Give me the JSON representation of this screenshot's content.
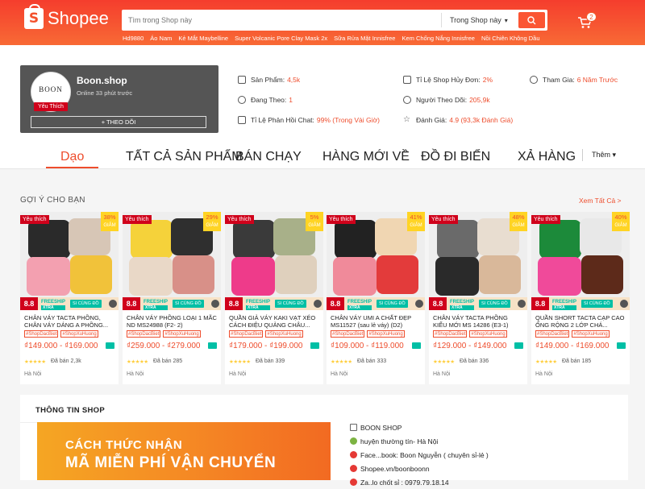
{
  "header": {
    "brand": "Shopee",
    "search_placeholder": "Tìm trong Shop này",
    "search_scope": "Trong Shop này",
    "cart_count": "2",
    "hints": [
      "Hd9880",
      "Áo Nam",
      "Kẻ Mắt Maybelline",
      "Super Volcanic Pore Clay Mask 2x",
      "Sữa Rửa Mặt Innisfree",
      "Kem Chống Nắng Innisfree",
      "Nồi Chiên Không Dầu"
    ]
  },
  "shop": {
    "logo_text": "BOON",
    "badge": "Yêu Thích",
    "name": "Boon.shop",
    "online": "Online 33 phút trước",
    "follow_label": "+ THEO DÕI",
    "stats": {
      "products_label": "Sản Phẩm:",
      "products_value": "4,5k",
      "following_label": "Đang Theo:",
      "following_value": "1",
      "chat_label": "Tỉ Lệ Phản Hồi Chat:",
      "chat_value": "99% (Trong Vài Giờ)",
      "cancel_label": "Tỉ Lệ Shop Hủy Đơn:",
      "cancel_value": "2%",
      "followers_label": "Người Theo Dõi:",
      "followers_value": "205,9k",
      "rating_label": "Đánh Giá:",
      "rating_value": "4.9 (93,3k Đánh Giá)",
      "joined_label": "Tham Gia:",
      "joined_value": "6 Năm Trước"
    }
  },
  "tabs": [
    "Dạo",
    "TẤT CẢ SẢN PHẨM",
    "BÁN CHẠY",
    "HÀNG MỚI VỀ",
    "ĐỒ ĐI BIỂN",
    "XẢ HÀNG"
  ],
  "more_label": "Thêm ▾",
  "section": {
    "title": "GỢI Ý CHO BẠN",
    "see_all": "Xem Tất Cả >"
  },
  "product_common": {
    "badge": "Yêu thích",
    "discount_suffix": "GIẢM",
    "mall_tag": "8.8",
    "freeship": "FREESHIP",
    "xtra": "XTRA",
    "gift": "SI CÙNG ĐỒ",
    "tags": [
      "#ShopDacBiet",
      "#ShopXuHuong"
    ],
    "location": "Hà Nội",
    "stars": "★★★★★"
  },
  "products": [
    {
      "name": "CHÂN VÁY TACTA PHỒNG, CHÂN VÁY DÁNG A PHỒNG...",
      "discount": "38%",
      "price": "₫149.000 - ₫169.000",
      "sold": "Đã bán 2,3k"
    },
    {
      "name": "CHÂN VÁY PHỒNG LOẠI 1 MÃC ND MS24988 (F2- 2)",
      "discount": "29%",
      "price": "₫259.000 - ₫279.000",
      "sold": "Đã bán 285"
    },
    {
      "name": "QUẦN GIẢ VÁY KAKI VẠT XÉO CÁCH ĐIỆU QUẢNG CHÂU...",
      "discount": "5%",
      "price": "₫179.000 - ₫199.000",
      "sold": "Đã bán 339"
    },
    {
      "name": "CHÂN VÁY UMI A CHẤT ĐẸP MS11527 (sau lẻ váy) (D2)",
      "discount": "41%",
      "price": "₫109.000 - ₫119.000",
      "sold": "Đã bán 333"
    },
    {
      "name": "CHÂN VÁY TACTA PHỒNG KIỂU MỚI MS 14286 (E3-1)",
      "discount": "48%",
      "price": "₫129.000 - ₫149.000",
      "sold": "Đã bán 336"
    },
    {
      "name": "QUẦN SHORT TACTA CẠP CAO ỐNG RỘNG 2 LỚP CHÁ...",
      "discount": "40%",
      "price": "₫149.000 - ₫169.000",
      "sold": "Đã bán 185"
    }
  ],
  "shop_info": {
    "title": "THÔNG TIN SHOP",
    "banner_line1": "CÁCH THỨC NHẬN",
    "banner_line2": "MÃ MIỄN PHÍ VẬN CHUYỂN",
    "contacts": [
      "BOON SHOP",
      "huyện thường tín- Hà Nội",
      "Face...book: Boon Nguyễn ( chuyên sỉ-lẻ )",
      "Shopee.vn/boonboonn",
      "Za..lo chốt sỉ : 0979.79.18.14"
    ]
  },
  "colors": {
    "brand": "#ee4d2d",
    "header": "#f53d2d",
    "freeship": "#00bfa5"
  }
}
